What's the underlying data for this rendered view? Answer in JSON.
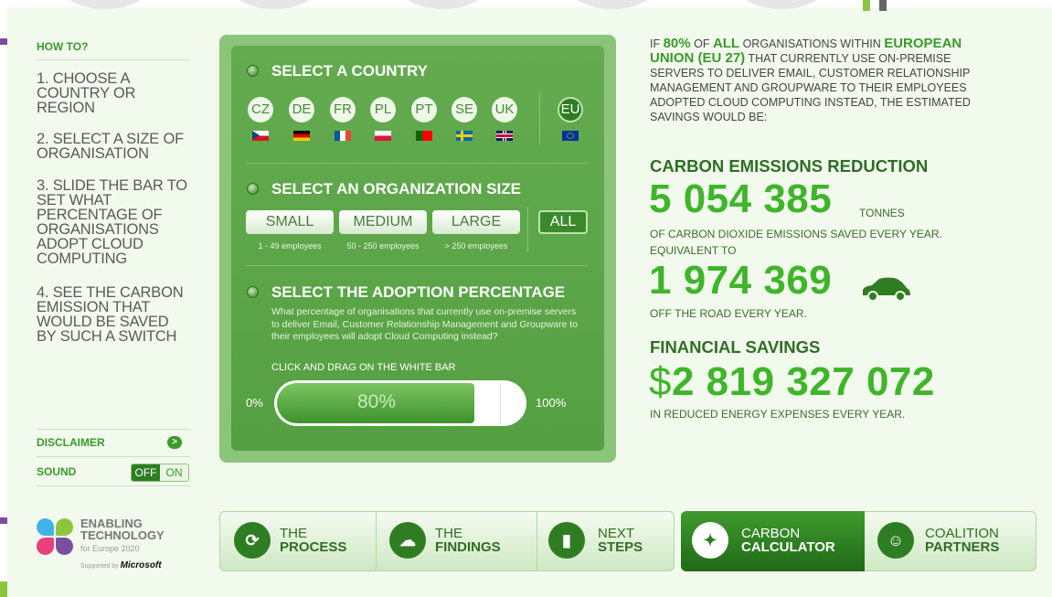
{
  "howto": {
    "title": "HOW TO?",
    "steps": [
      "1. CHOOSE A COUNTRY OR REGION",
      "2. SELECT A SIZE OF ORGANISATION",
      "3. SLIDE THE BAR TO SET WHAT PERCENTAGE OF ORGANISATIONS ADOPT CLOUD COMPUTING",
      "4. SEE THE CARBON EMISSION THAT WOULD BE SAVED BY SUCH A SWITCH"
    ]
  },
  "sidebar": {
    "disclaimer_label": "DISCLAIMER",
    "disclaimer_arrow": ">",
    "sound_label": "SOUND",
    "sound_off": "OFF",
    "sound_on": "ON",
    "sound_state": "off"
  },
  "logo": {
    "line1": "ENABLING",
    "line2": "TECHNOLOGY",
    "sub": "for Europe 2020",
    "supported_by": "Supported by",
    "sponsor": "Microsoft",
    "colors": [
      "#3fb3e8",
      "#8cc63f",
      "#e8407a",
      "#7a4fa0"
    ]
  },
  "country_section": {
    "title": "SELECT A COUNTRY",
    "countries": [
      "CZ",
      "DE",
      "FR",
      "PL",
      "PT",
      "SE",
      "UK"
    ],
    "region": "EU",
    "selected": "EU"
  },
  "size_section": {
    "title": "SELECT AN ORGANIZATION SIZE",
    "sizes": [
      {
        "label": "SMALL",
        "sub": "1 - 49 employees"
      },
      {
        "label": "MEDIUM",
        "sub": "50 - 250 employees"
      },
      {
        "label": "LARGE",
        "sub": "> 250 employees"
      }
    ],
    "all_label": "ALL",
    "selected": "ALL"
  },
  "adoption_section": {
    "title": "SELECT THE ADOPTION PERCENTAGE",
    "description": "What percentage of organisations that currently use on-premise servers to deliver Email, Customer Relationship Management and Groupware to their employees will adopt Cloud Computing instead?",
    "drag_label": "CLICK AND DRAG ON THE WHITE BAR",
    "min_label": "0%",
    "max_label": "100%",
    "value_label": "80%",
    "value": 0.8
  },
  "results": {
    "intro_lines": [
      [
        {
          "t": "IF ",
          "hl": false
        },
        {
          "t": "80%",
          "hl": true
        },
        {
          "t": " OF ",
          "hl": false
        },
        {
          "t": "ALL",
          "hl": true
        },
        {
          "t": " ORGANISATIONS WITHIN ",
          "hl": false
        },
        {
          "t": "EUROPEAN",
          "hl": true
        }
      ],
      [
        {
          "t": "UNION (EU 27)",
          "hl": true
        },
        {
          "t": " THAT CURRENTLY USE ON-PREMISE",
          "hl": false
        }
      ],
      [
        {
          "t": "SERVERS TO DELIVER EMAIL, CUSTOMER RELATIONSHIP",
          "hl": false
        }
      ],
      [
        {
          "t": "MANAGEMENT AND GROUPWARE TO THEIR EMPLOYEES",
          "hl": false
        }
      ],
      [
        {
          "t": "ADOPTED CLOUD COMPUTING INSTEAD, THE ESTIMATED",
          "hl": false
        }
      ],
      [
        {
          "t": "SAVINGS WOULD BE:",
          "hl": false
        }
      ]
    ],
    "carbon_title": "CARBON EMISSIONS REDUCTION",
    "carbon_value": "5 054 385",
    "carbon_unit": "TONNES",
    "carbon_desc": "OF CARBON DIOXIDE EMISSIONS SAVED EVERY YEAR.",
    "equivalent_label": "EQUIVALENT TO",
    "cars_value": "1 974 369",
    "cars_desc": "OFF THE ROAD EVERY YEAR.",
    "financial_title": "FINANCIAL SAVINGS",
    "currency": "$",
    "financial_value": "2 819 327 072",
    "financial_desc": "IN REDUCED ENERGY EXPENSES EVERY YEAR."
  },
  "nav": {
    "items": [
      {
        "line1": "THE",
        "line2": "PROCESS",
        "icon": "refresh-icon"
      },
      {
        "line1": "THE",
        "line2": "FINDINGS",
        "icon": "cloud-icon"
      },
      {
        "line1": "NEXT",
        "line2": "STEPS",
        "icon": "bar-chart-icon"
      },
      {
        "line1": "CARBON",
        "line2": "CALCULATOR",
        "icon": "footprint-icon"
      },
      {
        "line1": "COALITION",
        "line2": "PARTNERS",
        "icon": "people-icon"
      }
    ],
    "active": "CARBON CALCULATOR"
  },
  "colors": {
    "accent": "#3fb52a",
    "dark_green": "#2f6e24",
    "panel_green": "#5ea84a"
  }
}
